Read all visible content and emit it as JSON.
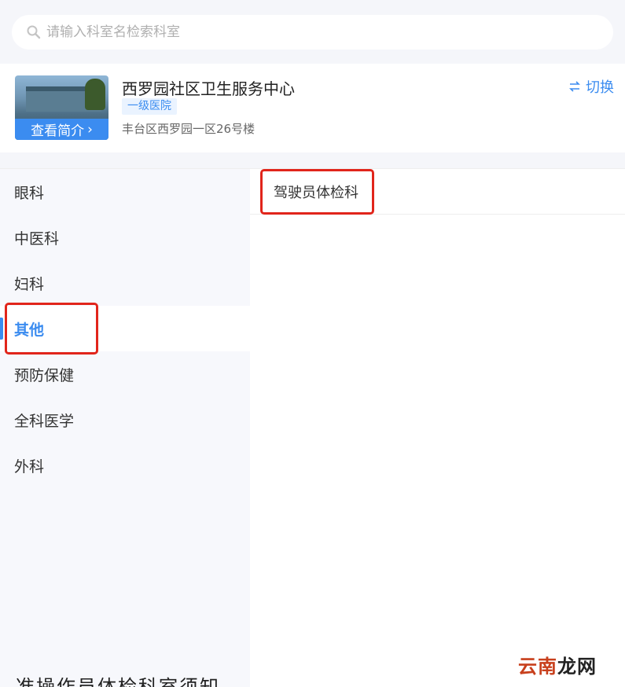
{
  "search": {
    "placeholder": "请输入科室名检索科室"
  },
  "hospital": {
    "name": "西罗园社区卫生服务中心",
    "level": "一级医院",
    "address": "丰台区西罗园一区26号楼",
    "intro_label": "查看简介",
    "switch_label": "切换"
  },
  "departments": [
    {
      "label": "眼科"
    },
    {
      "label": "中医科"
    },
    {
      "label": "妇科"
    },
    {
      "label": "其他"
    },
    {
      "label": "预防保健"
    },
    {
      "label": "全科医学"
    },
    {
      "label": "外科"
    }
  ],
  "active_department": "其他",
  "sub_departments": [
    {
      "label": "驾驶员体检科"
    }
  ],
  "bottom_text": "准操作员体检科室须知",
  "watermark": {
    "part1": "云南",
    "part2": "龙",
    "part3": "网"
  },
  "colors": {
    "accent": "#3b8cf0",
    "highlight": "#e1251b"
  }
}
